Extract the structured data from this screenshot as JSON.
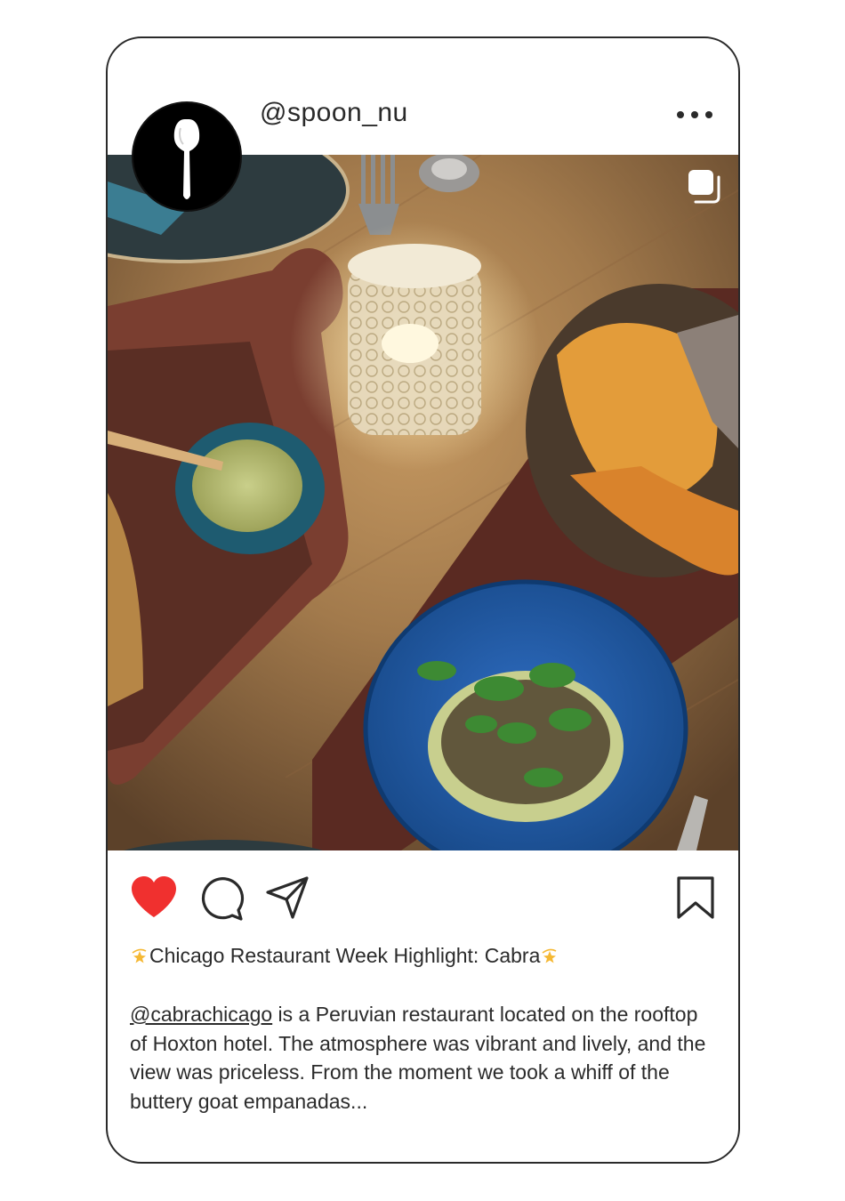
{
  "post": {
    "username": "@spoon_nu",
    "avatar_icon": "spoon-icon",
    "more_icon": "ellipsis-icon",
    "multi_image_icon": "carousel-icon",
    "photo_alt": "Overhead photo of a restaurant table: candle in a cut-glass holder, a bowl of green sauce with a wooden spoon, a bowl of orange tortilla chips, and a blue plate with a cilantro-topped dish",
    "actions": {
      "like_icon": "heart-icon",
      "comment_icon": "comment-icon",
      "share_icon": "send-icon",
      "save_icon": "bookmark-icon",
      "liked": true,
      "like_color": "#f0302f"
    },
    "headline": "Chicago Restaurant Week Highlight: Cabra",
    "headline_emoji": "dizzy-star-icon",
    "caption": {
      "mention": "@cabrachicago",
      "text": " is a Peruvian restaurant located on the rooftop of Hoxton hotel. The atmosphere was vibrant and lively, and the view was priceless. From the moment we took a whiff of the buttery goat empanadas..."
    }
  }
}
